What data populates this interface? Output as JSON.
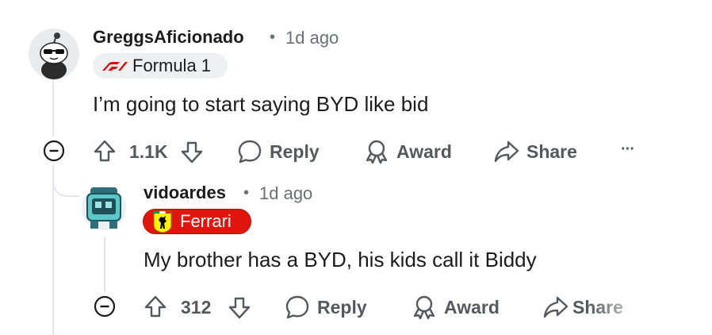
{
  "comments": [
    {
      "username": "GreggsAficionado",
      "separator": "•",
      "time": "1d ago",
      "flair": "Formula 1",
      "text": "I’m going to start saying BYD like bid",
      "score": "1.1K",
      "reply_label": "Reply",
      "award_label": "Award",
      "share_label": "Share",
      "more_label": "···"
    },
    {
      "username": "vidoardes",
      "separator": "•",
      "time": "1d ago",
      "flair": "Ferrari",
      "text": "My brother has a BYD, his kids call it Biddy",
      "score": "312",
      "reply_label": "Reply",
      "award_label": "Award",
      "share_label": "Share"
    }
  ],
  "colors": {
    "text": "#1c1c1c",
    "muted": "#6b7075",
    "action": "#54595e",
    "f1_red": "#e10600",
    "ferrari_red": "#e0150e",
    "ferrari_yellow": "#fff200",
    "thread_line": "#e3e5e8"
  },
  "icons": [
    "upvote-icon",
    "downvote-icon",
    "reply-bubble-icon",
    "award-icon",
    "share-arrow-icon",
    "collapse-icon",
    "f1-logo-icon",
    "ferrari-horse-icon"
  ]
}
